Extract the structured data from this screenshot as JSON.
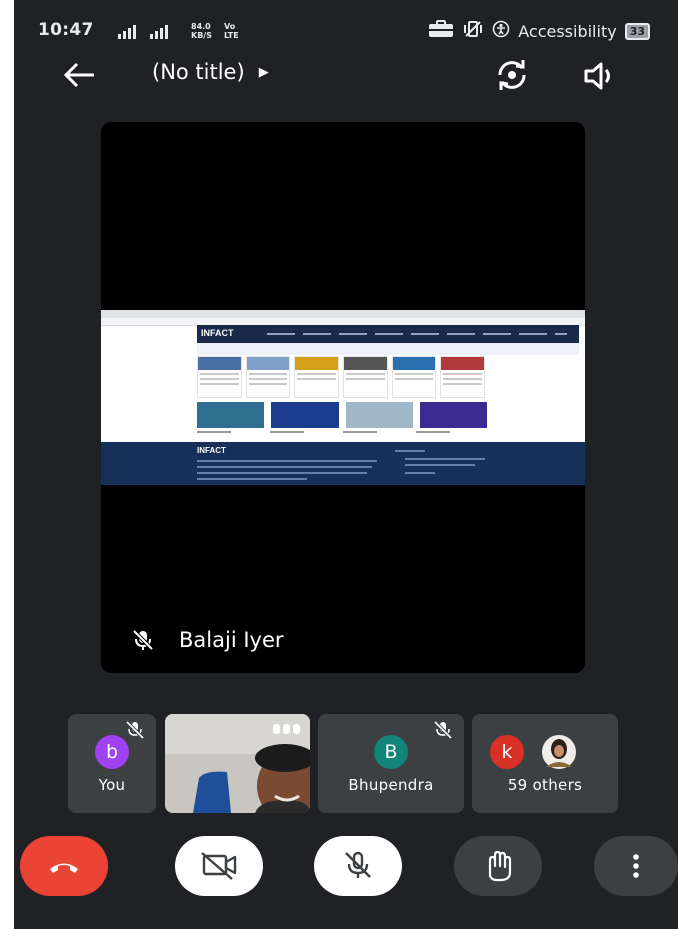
{
  "status_bar": {
    "time": "10:47",
    "signal": "ᴴ⁴ᴳ⺏ıl .ıl",
    "speed": "84.0\nKB/S",
    "network": "Vo\nLTE",
    "accessibility": "Accessibility",
    "battery": "33"
  },
  "header": {
    "title": "(No title)",
    "title_chevron": "▶",
    "back_icon": "arrow-left-icon",
    "camera_switch_icon": "camera-switch-icon",
    "speaker_icon": "speaker-icon"
  },
  "main_tile": {
    "participant_name": "Balaji Iyer",
    "muted": true,
    "content": "screen-share",
    "shared_logo": "INFACT"
  },
  "participants": [
    {
      "label": "You",
      "initial": "b",
      "color": "#a142f4",
      "muted": true
    },
    {
      "label": "",
      "video": true,
      "more_icon": "more-horizontal-icon"
    },
    {
      "label": "Bhupendra",
      "initial": "B",
      "color": "#12857a",
      "muted": true
    },
    {
      "label": "59 others",
      "initial": "k",
      "color": "#d93025"
    }
  ],
  "controls": {
    "end_call_icon": "end-call-icon",
    "camera_off_icon": "camera-off-icon",
    "mic_off_icon": "mic-off-icon",
    "raise_hand_icon": "raise-hand-icon",
    "more_icon": "more-vertical-icon"
  },
  "colors": {
    "background": "#202124",
    "tile": "#3c4043",
    "end_call": "#ea4335"
  }
}
